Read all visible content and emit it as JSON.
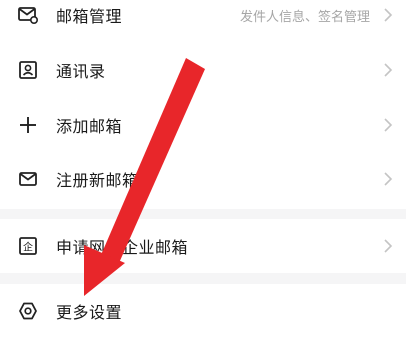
{
  "menu": {
    "items": [
      {
        "label": "邮箱管理",
        "hint": "发件人信息、签名管理",
        "icon": "mail-settings-icon"
      },
      {
        "label": "通讯录",
        "hint": "",
        "icon": "contacts-icon"
      },
      {
        "label": "添加邮箱",
        "hint": "",
        "icon": "plus-icon"
      },
      {
        "label": "注册新邮箱",
        "hint": "",
        "icon": "mail-icon"
      }
    ],
    "enterprise_item": {
      "label": "申请网易企业邮箱",
      "icon": "enterprise-icon"
    },
    "settings_item": {
      "label": "更多设置",
      "icon": "settings-gear-icon"
    }
  },
  "annotation": {
    "color": "#e8262a",
    "icon": "red-arrow-annotation"
  },
  "colors": {
    "text": "#1a1a1a",
    "hint": "#a6a6a6",
    "separator": "#f5f5f6",
    "chevron": "#c4c4c4"
  }
}
